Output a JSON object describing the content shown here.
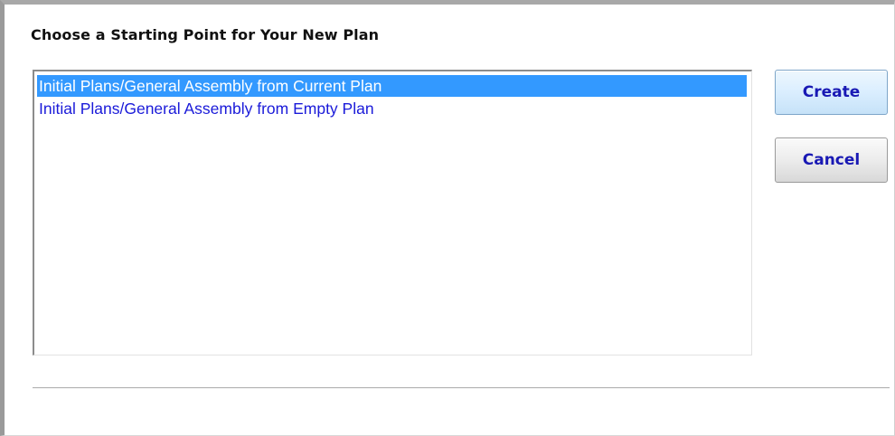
{
  "dialog": {
    "title": "Choose a Starting Point for Your New Plan"
  },
  "list": {
    "items": [
      {
        "label": "Initial Plans/General Assembly from Current Plan",
        "selected": true
      },
      {
        "label": "Initial Plans/General Assembly from Empty Plan",
        "selected": false
      }
    ]
  },
  "buttons": {
    "create_label": "Create",
    "cancel_label": "Cancel"
  },
  "colors": {
    "selection_bg": "#3399ff",
    "selection_text": "#ffffff",
    "item_text": "#1a1ad9",
    "button_text": "#1919b4"
  }
}
